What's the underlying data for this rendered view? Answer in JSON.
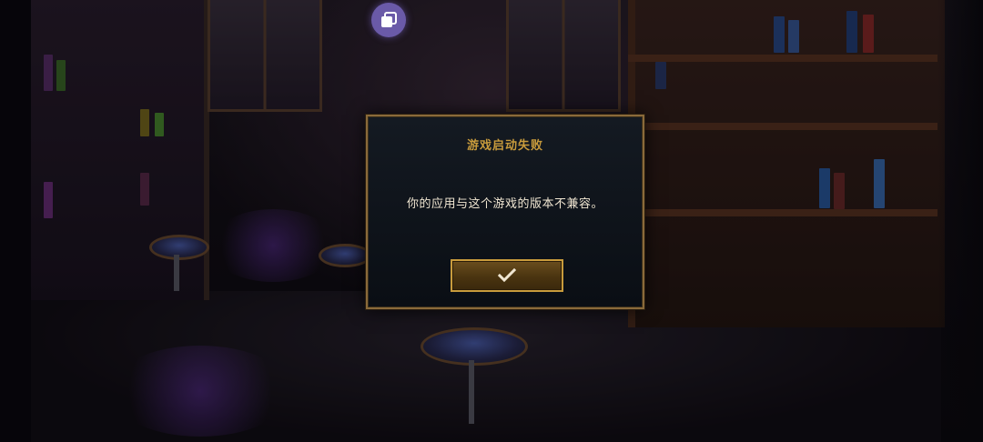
{
  "dialog": {
    "title": "游戏启动失败",
    "message": "你的应用与这个游戏的版本不兼容。",
    "confirm_icon": "check-icon"
  },
  "top_icon": "window-switch-icon",
  "colors": {
    "title": "#c89b3c",
    "message": "#f0e6d2",
    "border_gold": "#8a6a3a",
    "button_border": "#c89b3c",
    "dialog_bg": "#0a0e14",
    "top_icon_bg": "#6a5aa8"
  }
}
